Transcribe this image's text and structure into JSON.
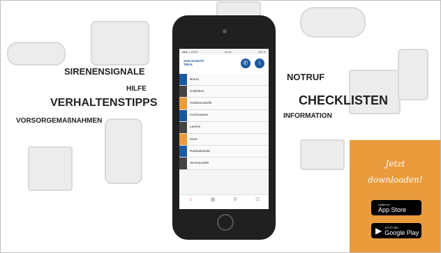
{
  "words": {
    "sirensignale": "SIRENENSIGNALE",
    "hilfe": "HILFE",
    "verhaltenstipps": "VERHALTENSTIPPS",
    "vorsorge": "VORSORGEMAßNAHMEN",
    "notruf": "NOTRUF",
    "checklisten": "CHECKLISTEN",
    "information": "INFORMATION"
  },
  "app": {
    "status_left": "●●●○○ AT&T",
    "status_time": "10:44",
    "status_right": "100 %",
    "logo_line1": "ZIVILSCHUTZ",
    "logo_line2": "TIROL",
    "phone_icon": "phone-icon",
    "info_icon": "info-icon",
    "menu": [
      {
        "label": "Brand",
        "color": "#1c5aa0"
      },
      {
        "label": "Erdbeben",
        "color": "#444444"
      },
      {
        "label": "Gefahrenstoffe",
        "color": "#ea9b3c"
      },
      {
        "label": "Hochwasser",
        "color": "#1c5aa0"
      },
      {
        "label": "Lawine",
        "color": "#444444"
      },
      {
        "label": "Mure",
        "color": "#ea9b3c"
      },
      {
        "label": "Radioaktivität",
        "color": "#1c5aa0"
      },
      {
        "label": "Stromausfall",
        "color": "#444444"
      }
    ]
  },
  "promo": {
    "line1": "Jetzt",
    "line2": "downloaden!",
    "appstore_small": "Laden im",
    "appstore_big": "App Store",
    "google_small": "JETZT BEI",
    "google_big": "Google Play"
  },
  "colors": {
    "blue": "#1c5aa0",
    "orange": "#ea9b3c",
    "dark": "#444444"
  }
}
